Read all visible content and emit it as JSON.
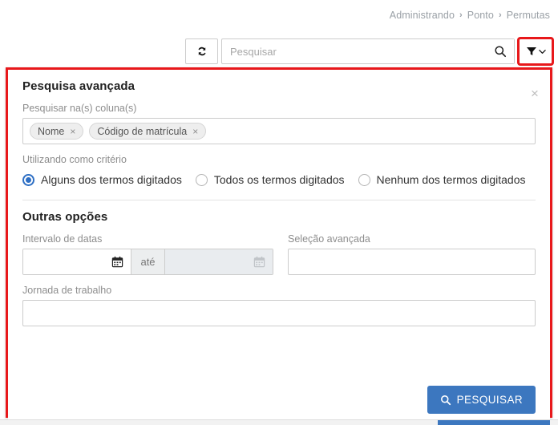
{
  "breadcrumb": {
    "items": [
      "Administrando",
      "Ponto",
      "Permutas"
    ],
    "separator": "›"
  },
  "toolbar": {
    "refresh_icon": "refresh-icon",
    "search_placeholder": "Pesquisar",
    "search_value": "",
    "search_icon": "search-icon",
    "filter_icon": "filter-funnel-icon",
    "filter_chevron": "chevron-down-icon"
  },
  "panel": {
    "close_label": "×",
    "highlight_color": "#e8181b",
    "section_one": {
      "title": "Pesquisa avançada",
      "columns_label": "Pesquisar na(s) coluna(s)",
      "tags": [
        {
          "label": "Nome",
          "remove": "×"
        },
        {
          "label": "Código de matrícula",
          "remove": "×"
        }
      ],
      "criteria_label": "Utilizando como critério",
      "criteria_options": [
        {
          "label": "Alguns dos termos digitados",
          "selected": true
        },
        {
          "label": "Todos os termos digitados",
          "selected": false
        },
        {
          "label": "Nenhum dos termos digitados",
          "selected": false
        }
      ]
    },
    "section_two": {
      "title": "Outras opções",
      "date_range_label": "Intervalo de datas",
      "date_from_value": "",
      "date_to_value": "",
      "date_separator": "até",
      "calendar_icon": "calendar-icon",
      "advanced_selection_label": "Seleção avançada",
      "advanced_selection_value": "",
      "work_schedule_label": "Jornada de trabalho",
      "work_schedule_value": ""
    },
    "submit_button": {
      "label": "PESQUISAR",
      "icon": "search-icon",
      "color": "#3c77bf"
    }
  }
}
